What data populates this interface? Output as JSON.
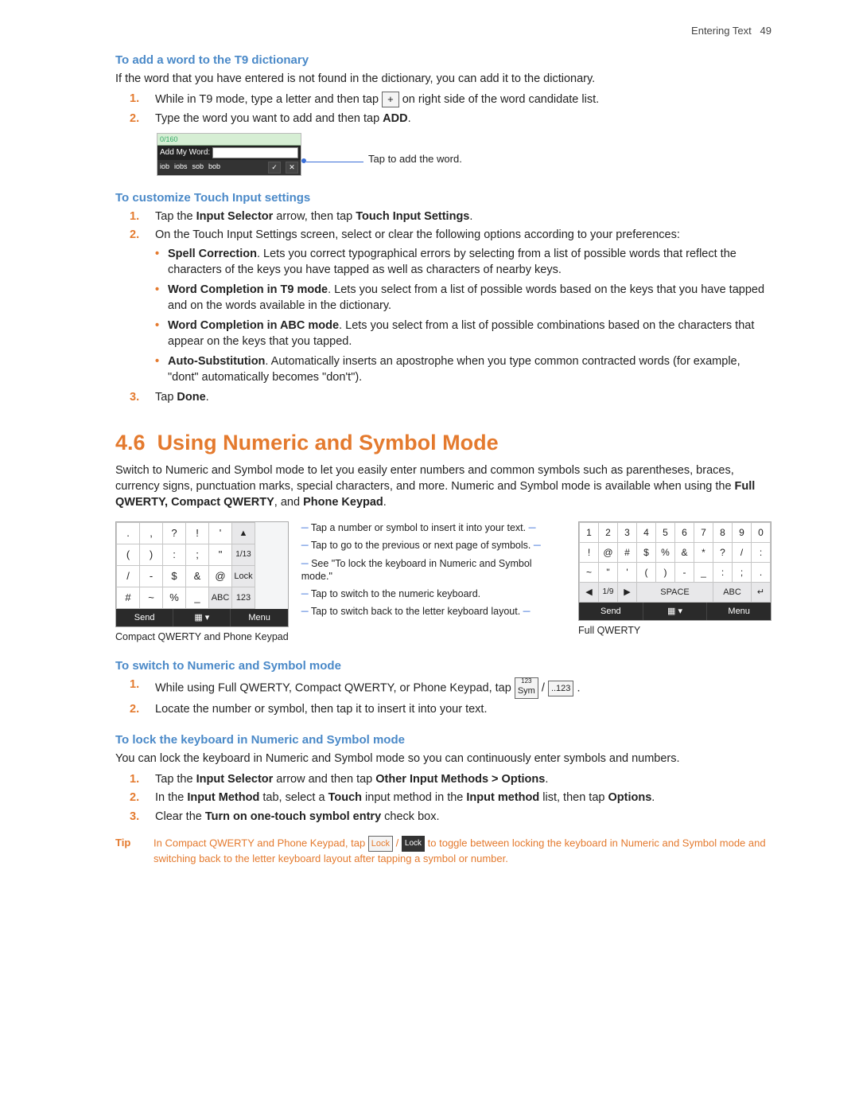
{
  "runningHead": {
    "chapter": "Entering Text",
    "page": "49"
  },
  "sec1": {
    "title": "To add a word to the T9 dictionary",
    "intro": "If the word that you have entered is not found in the dictionary, you can add it to the dictionary.",
    "step1a": "While in T9 mode, type a letter and then tap ",
    "plusIcon": "+",
    "step1b": " on right side of the word candidate list.",
    "step2a": "Type the word you want to add and then tap ",
    "step2bold": "ADD",
    "step2b": ".",
    "fig": {
      "counter": "0/160",
      "label": "Add My Word:",
      "suggestions": [
        "iob",
        "iobs",
        "sob",
        "bob"
      ],
      "callout": "Tap to add the word."
    }
  },
  "sec2": {
    "title": "To customize Touch Input settings",
    "step1a": "Tap the ",
    "step1b": "Input Selector",
    "step1c": " arrow, then tap ",
    "step1d": "Touch Input Settings",
    "step1e": ".",
    "step2": "On the Touch Input Settings screen, select or clear the following options according to your preferences:",
    "bullets": [
      {
        "b": "Spell Correction",
        "t": ". Lets you correct typographical errors by selecting from a list of possible words that reflect the characters of the keys you have tapped as well as characters of nearby keys."
      },
      {
        "b": "Word Completion in T9 mode",
        "t": ". Lets you select from a list of possible words based on the keys that you have tapped and on the words available in the dictionary."
      },
      {
        "b": "Word Completion in ABC mode",
        "t": ". Lets you select from a list of possible combinations based on the characters that appear on the keys that you tapped."
      },
      {
        "b": "Auto-Substitution",
        "t": ". Automatically inserts an apostrophe when you type common contracted words (for example, \"dont\" automatically becomes \"don't\")."
      }
    ],
    "step3a": "Tap ",
    "step3b": "Done",
    "step3c": "."
  },
  "sec3": {
    "number": "4.6",
    "title": "Using Numeric and Symbol Mode",
    "intro_a": "Switch to Numeric and Symbol mode to let you easily enter numbers and common symbols such as parentheses, braces, currency signs, punctuation marks, special characters, and more. Numeric and Symbol mode is available when using the ",
    "intro_b": "Full QWERTY, Compact QWERTY",
    "intro_c": ", and ",
    "intro_d": "Phone Keypad",
    "intro_e": ".",
    "callouts": {
      "c1": "Tap a number or symbol to insert it into your text.",
      "c2": "Tap to go to the previous or next page of symbols.",
      "c3": "See \"To lock the keyboard in Numeric and Symbol mode.\"",
      "c4": "Tap to switch to the numeric keyboard.",
      "c5": "Tap to switch back to the letter keyboard layout."
    },
    "kbCompact": {
      "rows": [
        [
          ".",
          ",",
          "?",
          "!",
          "'",
          "▲"
        ],
        [
          "(",
          ")",
          ":",
          ";",
          "\"",
          "1/13"
        ],
        [
          "/",
          "-",
          "$",
          "&",
          "@",
          "Lock"
        ],
        [
          "#",
          "~",
          "%",
          "_",
          "ABC",
          "123"
        ]
      ],
      "bottom": [
        "Send",
        "▦ ▾",
        "Menu"
      ],
      "caption": "Compact QWERTY and Phone Keypad"
    },
    "kbFull": {
      "rows": [
        [
          "1",
          "2",
          "3",
          "4",
          "5",
          "6",
          "7",
          "8",
          "9",
          "0"
        ],
        [
          "!",
          "@",
          "#",
          "$",
          "%",
          "&",
          "*",
          "?",
          "/",
          ":"
        ],
        [
          "~",
          "\"",
          "'",
          "(",
          ")",
          "-",
          "_",
          ":",
          ";",
          "."
        ]
      ],
      "pager": [
        "◀",
        "1/9",
        "▶",
        "SPACE",
        "ABC",
        "↵"
      ],
      "bottom": [
        "Send",
        "▦ ▾",
        "Menu"
      ],
      "caption": "Full QWERTY"
    }
  },
  "sec4": {
    "title": "To switch to Numeric and Symbol mode",
    "step1a": "While using Full QWERTY, Compact QWERTY, or Phone Keypad, tap ",
    "icon1top": "123",
    "icon1": "Sym",
    "slash": " / ",
    "icon2": "..123",
    "step1b": " .",
    "step2": "Locate the number or symbol, then tap it to insert it into your text."
  },
  "sec5": {
    "title": "To lock the keyboard in Numeric and Symbol mode",
    "intro": "You can lock the keyboard in Numeric and Symbol mode so you can continuously enter symbols and numbers.",
    "step1a": "Tap the ",
    "step1b": "Input Selector",
    "step1c": " arrow and then tap ",
    "step1d": "Other Input Methods > Options",
    "step1e": ".",
    "step2a": "In the ",
    "step2b": "Input Method",
    "step2c": " tab, select a ",
    "step2d": "Touch",
    "step2e": " input method in the ",
    "step2f": "Input method",
    "step2g": " list, then tap ",
    "step2h": "Options",
    "step2i": ".",
    "step3a": "Clear the ",
    "step3b": "Turn on one-touch symbol entry",
    "step3c": " check box."
  },
  "tip": {
    "label": "Tip",
    "a": "In Compact QWERTY and Phone Keypad, tap ",
    "icon1": "Lock",
    "slash": " / ",
    "icon2": "Lock",
    "b": " to toggle between locking the keyboard in Numeric and Symbol mode and switching back to the letter keyboard layout after tapping a symbol or number."
  }
}
